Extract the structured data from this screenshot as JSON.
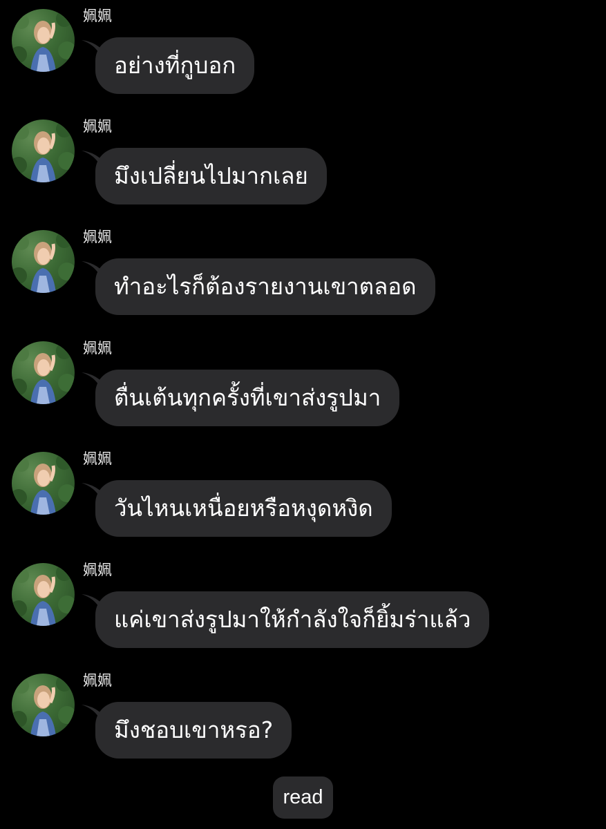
{
  "chat": {
    "messages": [
      {
        "sender": "姵姵",
        "text": "อย่างที่กูบอก"
      },
      {
        "sender": "姵姵",
        "text": "มึงเปลี่ยนไปมากเลย"
      },
      {
        "sender": "姵姵",
        "text": "ทำอะไรก็ต้องรายงานเขาตลอด"
      },
      {
        "sender": "姵姵",
        "text": "ตื่นเต้นทุกครั้งที่เขาส่งรูปมา"
      },
      {
        "sender": "姵姵",
        "text": "วันไหนเหนื่อยหรือหงุดหงิด"
      },
      {
        "sender": "姵姵",
        "text": "แค่เขาส่งรูปมาให้กำลังใจก็ยิ้มร่าแล้ว"
      },
      {
        "sender": "姵姵",
        "text": "มึงชอบเขาหรอ?"
      }
    ],
    "read_label": "read"
  },
  "theme": {
    "background": "#000000",
    "bubble": "#2b2b2d",
    "text": "#ffffff",
    "sender_text": "#e8e8e8"
  },
  "icons": {
    "avatar": "profile-photo-woman-in-garden",
    "bubble_tail": "speech-bubble-tail"
  }
}
